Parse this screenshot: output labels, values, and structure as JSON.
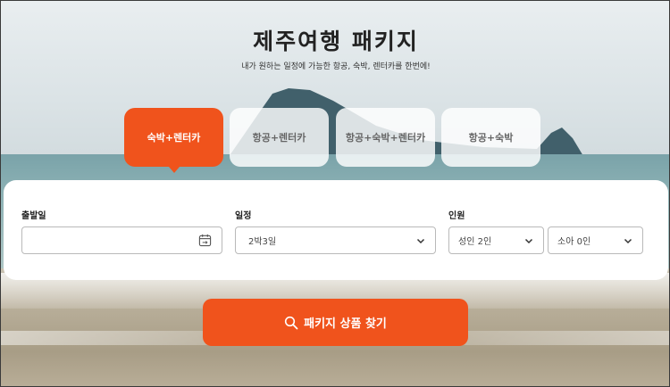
{
  "hero": {
    "title": "제주여행 패키지",
    "subtitle": "내가 원하는 일정에 가능한 항공, 숙박, 렌터카를 한번에!"
  },
  "tabs": [
    {
      "label": "숙박+렌터카",
      "active": true
    },
    {
      "label": "항공+렌터카",
      "active": false
    },
    {
      "label": "항공+숙박+렌터카",
      "active": false
    },
    {
      "label": "항공+숙박",
      "active": false
    }
  ],
  "form": {
    "departure": {
      "label": "출발일",
      "value": "",
      "icon": "calendar-icon"
    },
    "schedule": {
      "label": "일정",
      "value": "2박3일",
      "icon": "chevron-down-icon"
    },
    "people": {
      "label": "인원",
      "adult": "성인 2인",
      "child": "소아 0인"
    }
  },
  "search": {
    "label": "패키지 상품 찾기",
    "icon": "search-icon"
  },
  "colors": {
    "accent": "#f0531c",
    "panel": "#ffffff",
    "tab_inactive": "#ffffff"
  }
}
